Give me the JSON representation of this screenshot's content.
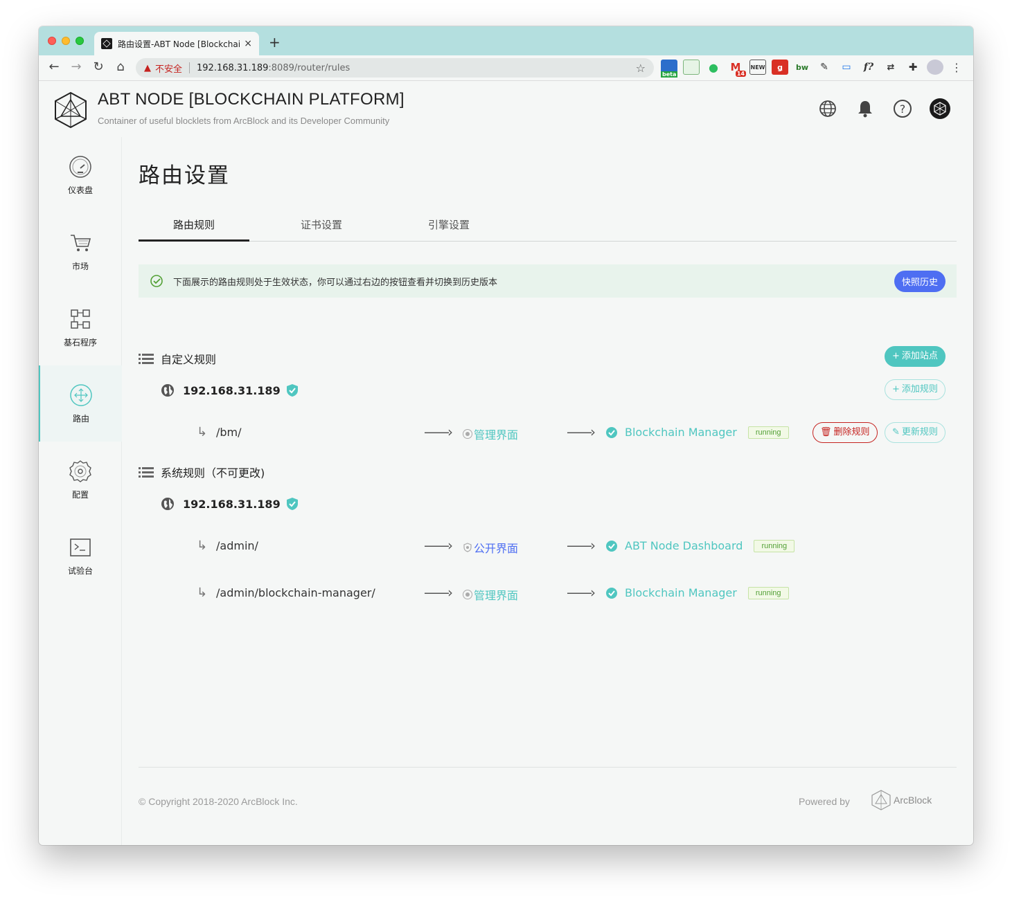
{
  "browser": {
    "tab_title": "路由设置-ABT Node [Blockchain",
    "tab_close": "×",
    "new_tab": "+",
    "insecure_label": "不安全",
    "url_host": "192.168.31.189",
    "url_path": ":8089/router/rules",
    "extensions": [
      {
        "name": "bitwarden-beta-icon",
        "label": "beta"
      },
      {
        "name": "sheets-icon",
        "label": ""
      },
      {
        "name": "evernote-icon",
        "label": ""
      },
      {
        "name": "gmail-icon",
        "label": "14"
      },
      {
        "name": "news-icon",
        "label": "NEW"
      },
      {
        "name": "pocket-icon",
        "label": ""
      },
      {
        "name": "bw-icon",
        "label": "bw"
      },
      {
        "name": "ext-icon",
        "label": ""
      },
      {
        "name": "screen-icon",
        "label": ""
      },
      {
        "name": "f-icon",
        "label": "f?"
      },
      {
        "name": "translate-icon",
        "label": ""
      },
      {
        "name": "puzzle-icon",
        "label": ""
      },
      {
        "name": "profile-avatar",
        "label": ""
      }
    ]
  },
  "header": {
    "title": "ABT NODE [BLOCKCHAIN PLATFORM]",
    "subtitle": "Container of useful blocklets from ArcBlock and its Developer Community"
  },
  "sidebar": {
    "items": [
      {
        "label": "仪表盘",
        "icon": "dashboard-icon"
      },
      {
        "label": "市场",
        "icon": "cart-icon"
      },
      {
        "label": "基石程序",
        "icon": "blocklets-icon"
      },
      {
        "label": "路由",
        "icon": "router-icon",
        "active": true
      },
      {
        "label": "配置",
        "icon": "gear-icon"
      },
      {
        "label": "试验台",
        "icon": "terminal-icon"
      }
    ]
  },
  "page": {
    "title": "路由设置",
    "tabs": [
      {
        "label": "路由规则",
        "active": true
      },
      {
        "label": "证书设置"
      },
      {
        "label": "引擎设置"
      }
    ],
    "notice": "下面展示的路由规则处于生效状态，你可以通过右边的按钮查看并切换到历史版本",
    "snapshot_button": "快照历史",
    "custom": {
      "title": "自定义规则",
      "add_site": "添加站点",
      "host": "192.168.31.189",
      "add_rule": "添加规则",
      "rules": [
        {
          "path": "/bm/",
          "interface": "管理界面",
          "target": "Blockchain Manager",
          "status": "running",
          "delete": "删除规则",
          "update": "更新规则"
        }
      ]
    },
    "system": {
      "title": "系统规则（不可更改)",
      "host": "192.168.31.189",
      "rules": [
        {
          "path": "/admin/",
          "interface": "公开界面",
          "target": "ABT Node Dashboard",
          "status": "running"
        },
        {
          "path": "/admin/blockchain-manager/",
          "interface": "管理界面",
          "target": "Blockchain Manager",
          "status": "running"
        }
      ]
    }
  },
  "footer": {
    "copyright": "© Copyright 2018-2020  ArcBlock Inc.",
    "powered_by": "Powered by",
    "brand": "ArcBlock"
  },
  "colors": {
    "accent": "#4fc6c0",
    "primary_blue": "#4e6ef2",
    "danger": "#c5221f",
    "tab_strip": "#b4dfdf"
  }
}
